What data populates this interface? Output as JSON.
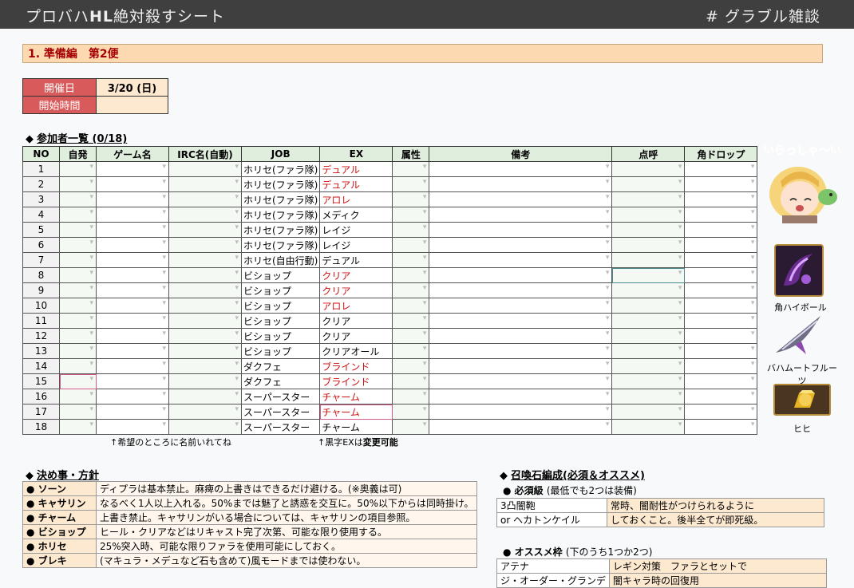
{
  "header": {
    "title_pre": "プロバハ",
    "title_bold": "HL",
    "title_post": "絶対殺すシート",
    "tag": "# グラブル雑談"
  },
  "section": {
    "title": "1. 準備編　第2便"
  },
  "info": {
    "date_label": "開催日",
    "date_value": "3/20 (日)",
    "start_label": "開始時間",
    "start_value": ""
  },
  "participants": {
    "title": "参加者一覧 (0/18)",
    "columns": [
      "NO",
      "自発",
      "ゲーム名",
      "IRC名(自動)",
      "JOB",
      "EX",
      "属性",
      "備考",
      "点呼",
      "角ドロップ"
    ],
    "rows": [
      {
        "no": "1",
        "job": "ホリセ(ファラ隊)",
        "ex": "デュアル",
        "ex_red": true
      },
      {
        "no": "2",
        "job": "ホリセ(ファラ隊)",
        "ex": "デュアル",
        "ex_red": true
      },
      {
        "no": "3",
        "job": "ホリセ(ファラ隊)",
        "ex": "アロレ",
        "ex_red": true
      },
      {
        "no": "4",
        "job": "ホリセ(ファラ隊)",
        "ex": "メディク",
        "ex_red": false
      },
      {
        "no": "5",
        "job": "ホリセ(ファラ隊)",
        "ex": "レイジ",
        "ex_red": false
      },
      {
        "no": "6",
        "job": "ホリセ(ファラ隊)",
        "ex": "レイジ",
        "ex_red": false
      },
      {
        "no": "7",
        "job": "ホリセ(自由行動)",
        "ex": "デュアル",
        "ex_red": false
      },
      {
        "no": "8",
        "job": "ビショップ",
        "ex": "クリア",
        "ex_red": true
      },
      {
        "no": "9",
        "job": "ビショップ",
        "ex": "クリア",
        "ex_red": true
      },
      {
        "no": "10",
        "job": "ビショップ",
        "ex": "アロレ",
        "ex_red": true
      },
      {
        "no": "11",
        "job": "ビショップ",
        "ex": "クリア",
        "ex_red": false
      },
      {
        "no": "12",
        "job": "ビショップ",
        "ex": "クリア",
        "ex_red": false
      },
      {
        "no": "13",
        "job": "ビショップ",
        "ex": "クリアオール",
        "ex_red": false
      },
      {
        "no": "14",
        "job": "ダクフェ",
        "ex": "ブラインド",
        "ex_red": true
      },
      {
        "no": "15",
        "job": "ダクフェ",
        "ex": "ブラインド",
        "ex_red": true
      },
      {
        "no": "16",
        "job": "スーパースター",
        "ex": "チャーム",
        "ex_red": true
      },
      {
        "no": "17",
        "job": "スーパースター",
        "ex": "チャーム",
        "ex_red": true
      },
      {
        "no": "18",
        "job": "スーパースター",
        "ex": "チャーム",
        "ex_red": false
      }
    ],
    "note_left": "↑希望のところに名前いれてね",
    "note_right_pre": "↑黒字EXは",
    "note_right_bold": "変更可能"
  },
  "side": {
    "welcome": "いらっしゃ〜い",
    "items": [
      {
        "label": "角ハイボール",
        "icon": "dark-horn-icon"
      },
      {
        "label": "バハムートフルーツ",
        "icon": "claw-blade-icon"
      },
      {
        "label": "ヒヒ",
        "icon": "gold-brick-icon"
      }
    ]
  },
  "rules": {
    "title": "決め事・方針",
    "items": [
      {
        "key": "● ソーン",
        "value": "ディプラは基本禁止。麻痺の上書きはできるだけ避ける。(※奥義は可)"
      },
      {
        "key": "● キャサリン",
        "value": "なるべく1人以上入れる。50%までは魅了と誘惑を交互に。50%以下からは同時掛け。"
      },
      {
        "key": "● チャーム",
        "value": "上書き禁止。キャサリンがいる場合については、キャサリンの項目参照。"
      },
      {
        "key": "● ビショップ",
        "value": "ヒール・クリアなどはリキャスト完了次第、可能な限り使用する。"
      },
      {
        "key": "● ホリセ",
        "value": "25%突入時、可能な限りファラを使用可能にしておく。"
      },
      {
        "key": "● ブレキ",
        "value": "(マキュラ・メデュなど石も含めて)風モードまでは使わない。"
      }
    ]
  },
  "summon": {
    "title": "召喚石編成(必須＆オススメ)",
    "required_label": "● 必須級",
    "required_note": "(最低でも2つは装備)",
    "required_rows": [
      {
        "a": "3凸闇鞄",
        "b": "常時、闇耐性がつけられるように"
      },
      {
        "a": "or ヘカトンケイル",
        "b": "しておくこと。後半全てが即死級。"
      }
    ],
    "recommend_label": "● オススメ枠",
    "recommend_note": "(下のうち1つか2つ)",
    "recommend_rows": [
      {
        "a": "アテナ",
        "b": "レギン対策　ファラとセットで"
      },
      {
        "a": "ジ・オーダー・グランデ",
        "b": "闇キャラ時の回復用"
      }
    ]
  }
}
